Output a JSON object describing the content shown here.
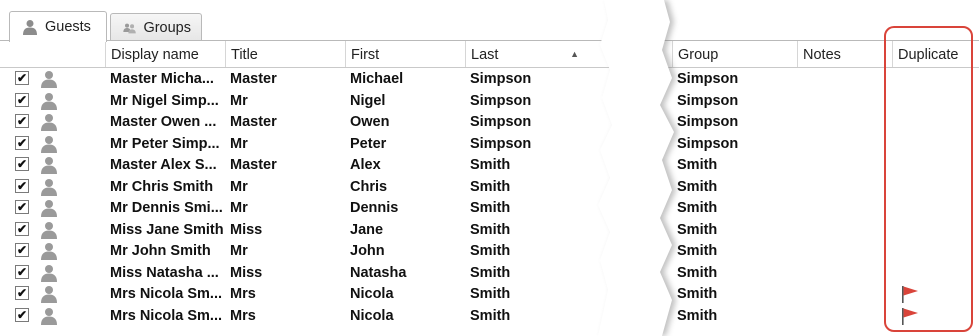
{
  "tabs": [
    {
      "label": "Guests",
      "icon": "person-icon",
      "active": true
    },
    {
      "label": "Groups",
      "icon": "people-icon",
      "active": false
    }
  ],
  "columns": {
    "display_name": "Display name",
    "title": "Title",
    "first": "First",
    "last": "Last",
    "group": "Group",
    "notes": "Notes",
    "duplicate": "Duplicate"
  },
  "sort": {
    "column": "Last",
    "direction": "ascending"
  },
  "rows": [
    {
      "checked": true,
      "display_name": "Master Micha...",
      "title": "Master",
      "first": "Michael",
      "last": "Simpson",
      "group": "Simpson",
      "notes": "",
      "duplicate": false
    },
    {
      "checked": true,
      "display_name": "Mr Nigel Simp...",
      "title": "Mr",
      "first": "Nigel",
      "last": "Simpson",
      "group": "Simpson",
      "notes": "",
      "duplicate": false
    },
    {
      "checked": true,
      "display_name": "Master Owen ...",
      "title": "Master",
      "first": "Owen",
      "last": "Simpson",
      "group": "Simpson",
      "notes": "",
      "duplicate": false
    },
    {
      "checked": true,
      "display_name": "Mr Peter Simp...",
      "title": "Mr",
      "first": "Peter",
      "last": "Simpson",
      "group": "Simpson",
      "notes": "",
      "duplicate": false
    },
    {
      "checked": true,
      "display_name": "Master Alex S...",
      "title": "Master",
      "first": "Alex",
      "last": "Smith",
      "group": "Smith",
      "notes": "",
      "duplicate": false
    },
    {
      "checked": true,
      "display_name": "Mr Chris Smith",
      "title": "Mr",
      "first": "Chris",
      "last": "Smith",
      "group": "Smith",
      "notes": "",
      "duplicate": false
    },
    {
      "checked": true,
      "display_name": "Mr Dennis Smi...",
      "title": "Mr",
      "first": "Dennis",
      "last": "Smith",
      "group": "Smith",
      "notes": "",
      "duplicate": false
    },
    {
      "checked": true,
      "display_name": "Miss Jane Smith",
      "title": "Miss",
      "first": "Jane",
      "last": "Smith",
      "group": "Smith",
      "notes": "",
      "duplicate": false
    },
    {
      "checked": true,
      "display_name": "Mr John Smith",
      "title": "Mr",
      "first": "John",
      "last": "Smith",
      "group": "Smith",
      "notes": "",
      "duplicate": false
    },
    {
      "checked": true,
      "display_name": "Miss Natasha ...",
      "title": "Miss",
      "first": "Natasha",
      "last": "Smith",
      "group": "Smith",
      "notes": "",
      "duplicate": false
    },
    {
      "checked": true,
      "display_name": "Mrs Nicola Sm...",
      "title": "Mrs",
      "first": "Nicola",
      "last": "Smith",
      "group": "Smith",
      "notes": "",
      "duplicate": true
    },
    {
      "checked": true,
      "display_name": "Mrs Nicola Sm...",
      "title": "Mrs",
      "first": "Nicola",
      "last": "Smith",
      "group": "Smith",
      "notes": "",
      "duplicate": true
    }
  ],
  "colors": {
    "flag": "#d9443a",
    "highlight": "#d9443a",
    "person_icon": "#9a9a9a"
  }
}
